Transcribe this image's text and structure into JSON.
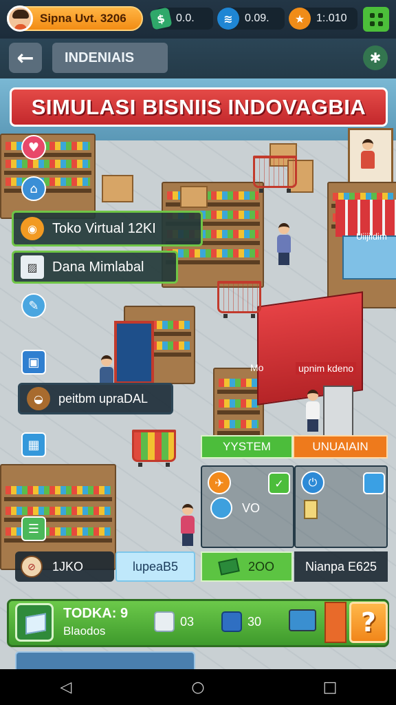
{
  "player": {
    "name_label": "Sipna Uvt. 3206"
  },
  "resources": [
    {
      "icon": "cash-icon",
      "value": "0.0."
    },
    {
      "icon": "gem-icon",
      "value": "0.09."
    },
    {
      "icon": "star-coin-icon",
      "value": "1:.010"
    }
  ],
  "header": {
    "location_label": "INDENIAIS"
  },
  "title_banner": "SIMULASI BISNIIS INDOVAGBIA",
  "side_menu": [
    {
      "icon": "coin-icon",
      "label": "Toko Virtual 12KI"
    },
    {
      "icon": "box-icon",
      "label": "Dana Mimlabal"
    },
    {
      "icon": "bowl-icon",
      "label": "peitbm upraDAL"
    }
  ],
  "scene_labels": {
    "mo": "Mo",
    "upnim_kdeno": "upnim kdeno",
    "stall_sign": "Uiijiidim",
    "vo": "VO"
  },
  "tabs": {
    "system": "YYSTEM",
    "unlock": "UNUAIAIN"
  },
  "stats": {
    "left_value": "1JKO",
    "upgrade_button": "lupeaB5",
    "cash_value": "2OO",
    "right_value": "Nianpa E625"
  },
  "hud": {
    "title": "TODKA: 9",
    "subtitle": "Blaodos",
    "item1_value": "03",
    "item2_value": "30",
    "help_symbol": "?"
  },
  "nav": {
    "back": "◁",
    "home": "○",
    "recents": "□"
  }
}
